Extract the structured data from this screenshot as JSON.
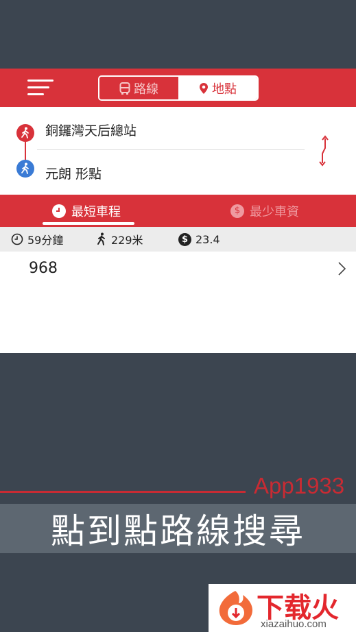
{
  "header": {
    "menu_icon": "menu-icon",
    "tabs": [
      {
        "label": "路線",
        "icon": "bus-icon",
        "selected": false
      },
      {
        "label": "地點",
        "icon": "location-pin-icon",
        "selected": true
      }
    ]
  },
  "trip": {
    "origin": "銅鑼灣天后總站",
    "destination": "元朗 形點",
    "origin_icon": "walk-icon",
    "destination_icon": "walk-icon",
    "swap_icon": "swap-icon"
  },
  "sort": {
    "options": [
      {
        "label": "最短車程",
        "icon": "clock-icon",
        "active": true
      },
      {
        "label": "最少車資",
        "icon": "dollar-icon",
        "active": false
      }
    ]
  },
  "results": [
    {
      "duration": "59分鐘",
      "walk": "229米",
      "fare": "23.4",
      "route": "968"
    }
  ],
  "promo": {
    "brand": "App1933",
    "caption": "點到點路線搜尋"
  },
  "watermark": {
    "title": "下载火",
    "url": "xiazaihuo.com"
  },
  "colors": {
    "primary": "#d8323a",
    "background": "#3c4550",
    "accent_blue": "#3a7bd5"
  }
}
